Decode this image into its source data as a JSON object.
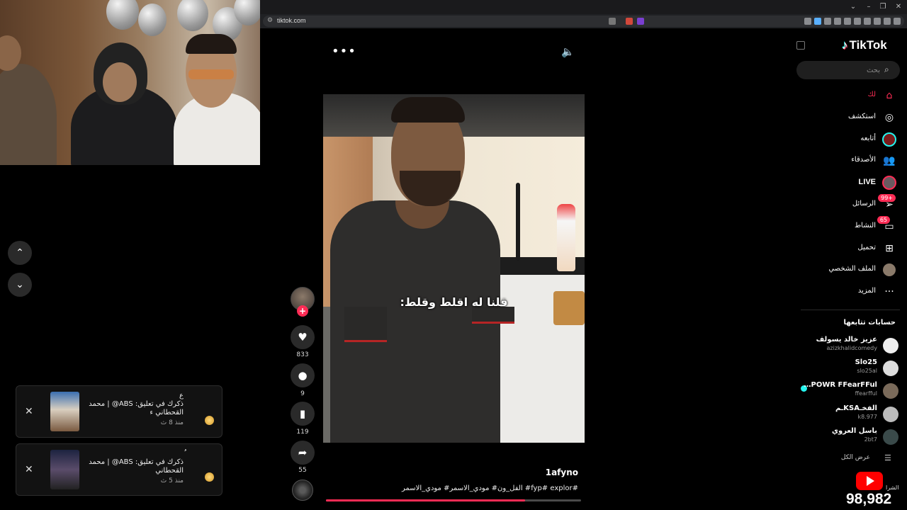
{
  "browser": {
    "url": "tiktok.com",
    "window_controls": [
      "⌄",
      "–",
      "❐",
      "✕"
    ]
  },
  "player": {
    "caption_overlay": "قلنا له اقلط وقلط:",
    "author": "1afyno",
    "description": "#fyp# explor# الفل_ون# مودي_الاسمر# مودي_الاسمر",
    "progress": 0.78,
    "likes": "833",
    "comments": "9",
    "saves": "119",
    "shares": "55"
  },
  "notifications": [
    {
      "line1": "ع",
      "line2": "ذكرك في تعليق: ABS@ | محمد",
      "line3": "القحطاني ء",
      "time": "منذ 8 ث"
    },
    {
      "line1": "ُ",
      "line2": "ذكرك في تعليق: ABS@ | محمد",
      "line3": "القحطاني",
      "time": "منذ 5 ث"
    }
  ],
  "sidebar": {
    "logo": "TikTok",
    "search_placeholder": "بحث",
    "nav": [
      {
        "label": "لك",
        "icon": "home-icon"
      },
      {
        "label": "استكشف",
        "icon": "compass-icon"
      },
      {
        "label": "أتابعه",
        "icon": "following-avatar-icon"
      },
      {
        "label": "الأصدقاء",
        "icon": "friends-icon"
      },
      {
        "label": "LIVE",
        "icon": "live-avatar-icon"
      },
      {
        "label": "الرسائل",
        "icon": "messages-icon",
        "badge": "99+"
      },
      {
        "label": "النشاط",
        "icon": "activity-icon",
        "badge": "65"
      },
      {
        "label": "تحميل",
        "icon": "upload-icon"
      },
      {
        "label": "الملف الشخصي",
        "icon": "profile-avatar-icon"
      },
      {
        "label": "المزيد",
        "icon": "more-icon"
      }
    ],
    "following_title": "حسابات تتابعها",
    "accounts": [
      {
        "name": "عزيز خالد يسولف",
        "handle": "azizkhalidcomedy"
      },
      {
        "name": "Slo25",
        "handle": "slo25al"
      },
      {
        "name": "POWR FFearFFul…",
        "handle": "ffearfful"
      },
      {
        "name": "الفخـKSAـم",
        "handle": "k8.977"
      },
      {
        "name": "باسل العروي",
        "handle": "2bt7"
      }
    ],
    "see_all": "عرض الكل"
  },
  "overlay": {
    "counter_label": "الشرا",
    "counter_value": "98,982"
  },
  "colors": {
    "accent": "#fe2c55",
    "cyan": "#25f4ee"
  }
}
